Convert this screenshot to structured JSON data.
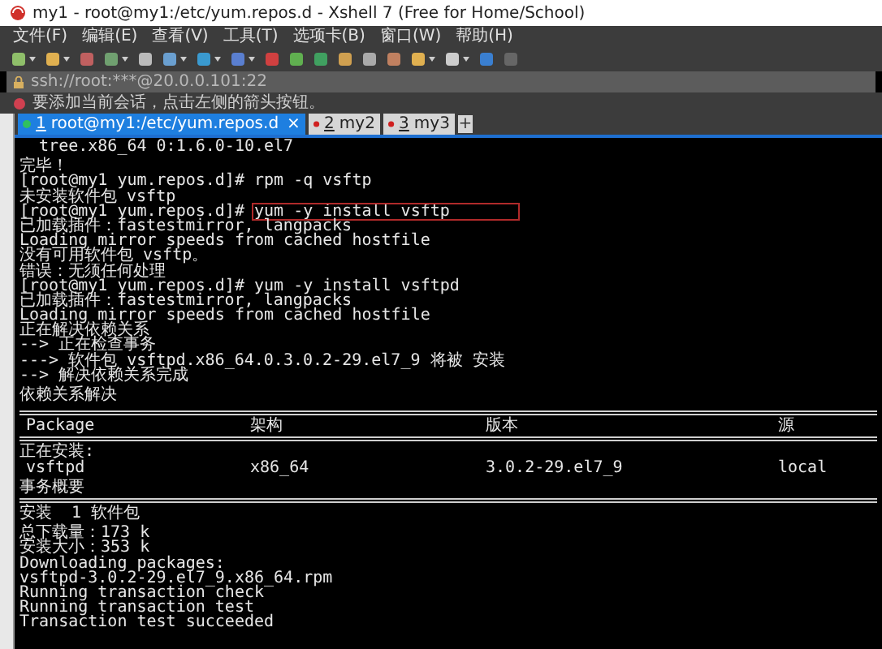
{
  "window": {
    "title": "my1 - root@my1:/etc/yum.repos.d - Xshell 7 (Free for Home/School)"
  },
  "menu": [
    "文件(F)",
    "编辑(E)",
    "查看(V)",
    "工具(T)",
    "选项卡(B)",
    "窗口(W)",
    "帮助(H)"
  ],
  "address_bar": {
    "value": "ssh://root:***@20.0.0.101:22"
  },
  "hint_bar": {
    "text": "要添加当前会话，点击左侧的箭头按钮。"
  },
  "tabs": [
    {
      "number": "1",
      "label": "root@my1:/etc/yum.repos.d",
      "selected": true,
      "close": "×"
    },
    {
      "number": "2",
      "label": "my2",
      "selected": false
    },
    {
      "number": "3",
      "label": "my3",
      "selected": false
    }
  ],
  "new_tab": "+",
  "terminal": [
    {
      "kind": "text",
      "text": "  tree.x86_64 0:1.6.0-10.el7"
    },
    {
      "kind": "blank"
    },
    {
      "kind": "text",
      "text": "完毕！"
    },
    {
      "kind": "command",
      "prompt": "[root@my1 yum.repos.d]#",
      "command": "rpm -q vsftp",
      "highlighted": false
    },
    {
      "kind": "text",
      "text": "未安装软件包 vsftp"
    },
    {
      "kind": "command",
      "prompt": "[root@my1 yum.repos.d]#",
      "command": "yum -y install vsftp",
      "highlighted": true
    },
    {
      "kind": "text",
      "text": "已加载插件：fastestmirror, langpacks"
    },
    {
      "kind": "text",
      "text": "Loading mirror speeds from cached hostfile"
    },
    {
      "kind": "text",
      "text": "没有可用软件包 vsftp。"
    },
    {
      "kind": "text",
      "text": "错误：无须任何处理"
    },
    {
      "kind": "command",
      "prompt": "[root@my1 yum.repos.d]#",
      "command": "yum -y install vsftpd",
      "highlighted": false
    },
    {
      "kind": "text",
      "text": "已加载插件：fastestmirror, langpacks"
    },
    {
      "kind": "text",
      "text": "Loading mirror speeds from cached hostfile"
    },
    {
      "kind": "text",
      "text": "正在解决依赖关系"
    },
    {
      "kind": "text",
      "text": "--> 正在检查事务"
    },
    {
      "kind": "text",
      "text": "---> 软件包 vsftpd.x86_64.0.3.0.2-29.el7_9 将被 安装"
    },
    {
      "kind": "text",
      "text": "--> 解决依赖关系完成"
    },
    {
      "kind": "blank"
    },
    {
      "kind": "text",
      "text": "依赖关系解决"
    },
    {
      "kind": "blank"
    },
    {
      "kind": "rule"
    },
    {
      "kind": "row",
      "cells": [
        "Package",
        "架构",
        "版本",
        "源"
      ]
    },
    {
      "kind": "rule"
    },
    {
      "kind": "text",
      "text": "正在安装:"
    },
    {
      "kind": "row",
      "cells": [
        "vsftpd",
        "x86_64",
        "3.0.2-29.el7_9",
        "local"
      ]
    },
    {
      "kind": "blank"
    },
    {
      "kind": "text",
      "text": "事务概要"
    },
    {
      "kind": "rule"
    },
    {
      "kind": "text",
      "text": "安装  1 软件包"
    },
    {
      "kind": "blank"
    },
    {
      "kind": "text",
      "text": "总下载量：173 k"
    },
    {
      "kind": "text",
      "text": "安装大小：353 k"
    },
    {
      "kind": "text",
      "text": "Downloading packages:"
    },
    {
      "kind": "text",
      "text": "vsftpd-3.0.2-29.el7_9.x86_64.rpm"
    },
    {
      "kind": "text",
      "text": "Running transaction check"
    },
    {
      "kind": "text",
      "text": "Running transaction test"
    },
    {
      "kind": "text",
      "text": "Transaction test succeeded"
    }
  ]
}
